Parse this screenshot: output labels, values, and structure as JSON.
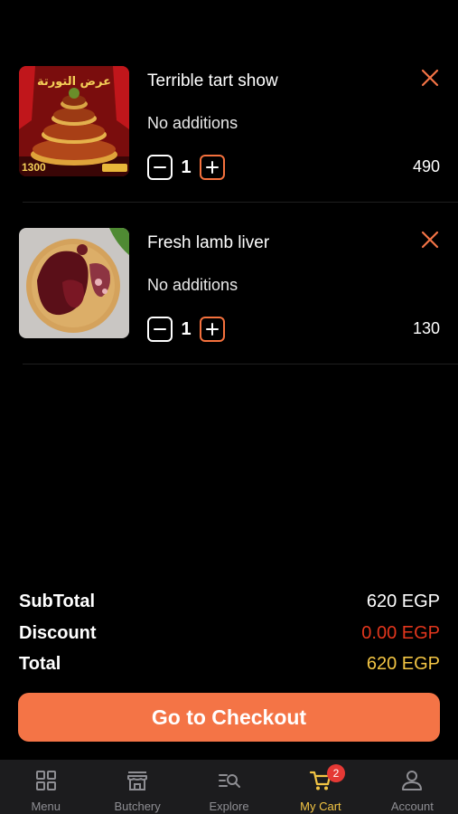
{
  "cart": {
    "items": [
      {
        "title": "Terrible tart show",
        "additions": "No additions",
        "quantity": "1",
        "price": "490",
        "image_text": "عرض التورتة",
        "image_price": "1300"
      },
      {
        "title": "Fresh lamb liver",
        "additions": "No additions",
        "quantity": "1",
        "price": "130"
      }
    ]
  },
  "summary": {
    "subtotal_label": "SubTotal",
    "subtotal_value": "620 EGP",
    "discount_label": "Discount",
    "discount_value": "0.00 EGP",
    "total_label": "Total",
    "total_value": "620 EGP"
  },
  "checkout_label": "Go to Checkout",
  "nav": {
    "items": [
      {
        "label": "Menu",
        "icon": "grid-icon"
      },
      {
        "label": "Butchery",
        "icon": "store-icon"
      },
      {
        "label": "Explore",
        "icon": "search-list-icon"
      },
      {
        "label": "My Cart",
        "icon": "cart-icon",
        "badge": "2",
        "active": true
      },
      {
        "label": "Account",
        "icon": "person-icon"
      }
    ]
  },
  "colors": {
    "accent": "#f47446",
    "total": "#f3c544",
    "discount": "#e2361d",
    "background": "#000000",
    "nav_bg": "#1c1c1e"
  }
}
